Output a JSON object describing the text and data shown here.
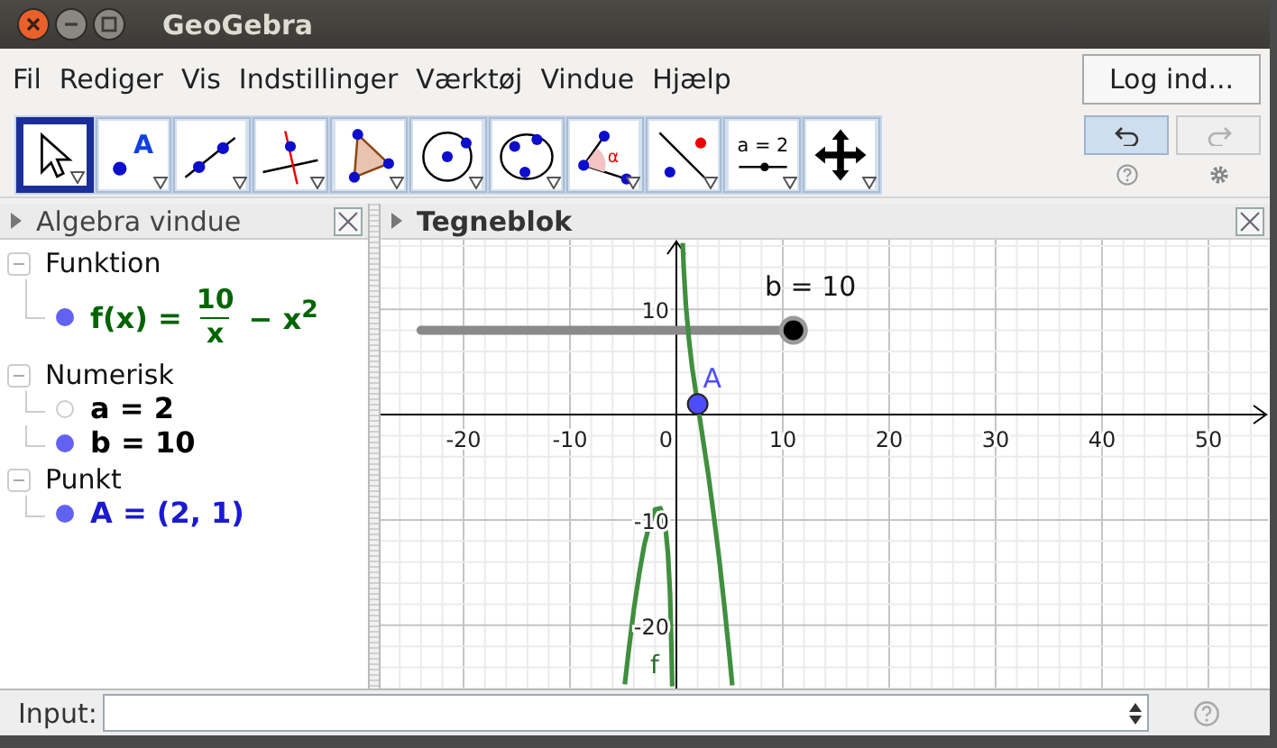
{
  "window": {
    "title": "GeoGebra"
  },
  "menu": {
    "items": [
      "Fil",
      "Rediger",
      "Vis",
      "Indstillinger",
      "Værktøj",
      "Vindue",
      "Hjælp"
    ],
    "login": "Log ind..."
  },
  "toolbar": {
    "tools": [
      {
        "kind": "move",
        "selected": true
      },
      {
        "kind": "point",
        "label": "A",
        "selected": false
      },
      {
        "kind": "line",
        "selected": false
      },
      {
        "kind": "perpendicular",
        "selected": false
      },
      {
        "kind": "polygon",
        "selected": false
      },
      {
        "kind": "circle",
        "selected": false
      },
      {
        "kind": "conic",
        "selected": false
      },
      {
        "kind": "angle",
        "label": "α",
        "selected": false
      },
      {
        "kind": "reflect",
        "selected": false
      },
      {
        "kind": "slider",
        "label": "a = 2",
        "selected": false
      },
      {
        "kind": "pan",
        "selected": false
      }
    ],
    "undo": {
      "disabled": false
    },
    "redo": {
      "disabled": true
    }
  },
  "algebra": {
    "title": "Algebra vindue",
    "groups": [
      {
        "label": "Funktion",
        "expanded": true,
        "items": [
          {
            "kind": "fraction",
            "lhs": "f(x) =",
            "numerator": "10",
            "denominator": "x",
            "rest": "− x$^{2}$",
            "visible": true,
            "color": "#006400"
          }
        ]
      },
      {
        "label": "Numerisk",
        "expanded": true,
        "items": [
          {
            "kind": "plain",
            "text": "a = 2",
            "visible": false,
            "color": "#000000"
          },
          {
            "kind": "plain",
            "text": "b = 10",
            "visible": true,
            "color": "#000000"
          }
        ]
      },
      {
        "label": "Punkt",
        "expanded": true,
        "items": [
          {
            "kind": "plain",
            "text": "A = (2, 1)",
            "visible": true,
            "color": "#1a1ad0"
          }
        ]
      }
    ]
  },
  "graphics": {
    "title": "Tegneblok",
    "slider": {
      "label": "b = 10",
      "level": 1
    },
    "chart_data": {
      "type": "line",
      "x": [
        -4.85,
        -4.5,
        -4,
        -3.5,
        -3,
        -2.5,
        -2,
        -1.5,
        -1.2,
        -1,
        -0.8,
        -0.6,
        -0.45,
        -0.39,
        0.6,
        0.7,
        0.9,
        1.2,
        1.5,
        2,
        2.5,
        3,
        3.5,
        4,
        4.5,
        5,
        5.25
      ],
      "series": [
        {
          "name": "f",
          "color": "#3f8f3f",
          "values": [
            -25.6,
            -22.5,
            -18.5,
            -15.1,
            -12.3,
            -10.3,
            -9,
            -8.9,
            -9.8,
            -11,
            -13.1,
            -17,
            -22.4,
            -25.8,
            16.3,
            13.8,
            10.3,
            6.9,
            4.4,
            1,
            -2.3,
            -5.7,
            -9.4,
            -13.5,
            -18,
            -23,
            -25.7
          ]
        },
        {
          "name": "A",
          "color": "#4d4dff",
          "marker": true,
          "values": [
            null,
            null,
            null,
            null,
            null,
            null,
            null,
            null,
            null,
            null,
            null,
            null,
            null,
            null,
            null,
            null,
            null,
            null,
            null,
            1,
            null,
            null,
            null,
            null,
            null,
            null,
            null
          ]
        }
      ],
      "grid": true,
      "xlim": [
        -27.8,
        55.6
      ],
      "ylim": [
        -26,
        16.6
      ],
      "xticks": [
        -20,
        -10,
        0,
        10,
        20,
        30,
        40,
        50
      ],
      "yticks": [
        -20,
        -10,
        10
      ]
    }
  },
  "input": {
    "label": "Input:"
  }
}
